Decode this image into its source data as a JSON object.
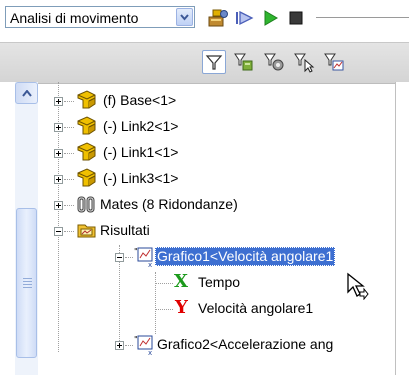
{
  "toolbar": {
    "study_select": "Analisi di movimento",
    "icons": [
      "calculate-icon",
      "play-from-start-icon",
      "play-icon",
      "stop-icon"
    ]
  },
  "filterbar": {
    "icons": [
      "filter-icon",
      "filter-animation-icon",
      "filter-driving-icon",
      "filter-selected-icon",
      "filter-results-icon"
    ]
  },
  "colors": {
    "selection": "#3d6fd1",
    "gear_yellow": "#f0c000",
    "x_green": "#1c9a1c",
    "y_red": "#e00000"
  },
  "tree": {
    "items": [
      {
        "label": "(f) Base<1>"
      },
      {
        "label": "(-) Link2<1>"
      },
      {
        "label": "(-) Link1<1>"
      },
      {
        "label": "(-) Link3<1>"
      },
      {
        "label": "Mates (8 Ridondanze)"
      },
      {
        "label": "Risultati"
      },
      {
        "label": "Grafico1<Velocità angolare1"
      },
      {
        "label": "Tempo"
      },
      {
        "label": "Velocità angolare1"
      },
      {
        "label": "Grafico2<Accelerazione ang"
      }
    ]
  }
}
